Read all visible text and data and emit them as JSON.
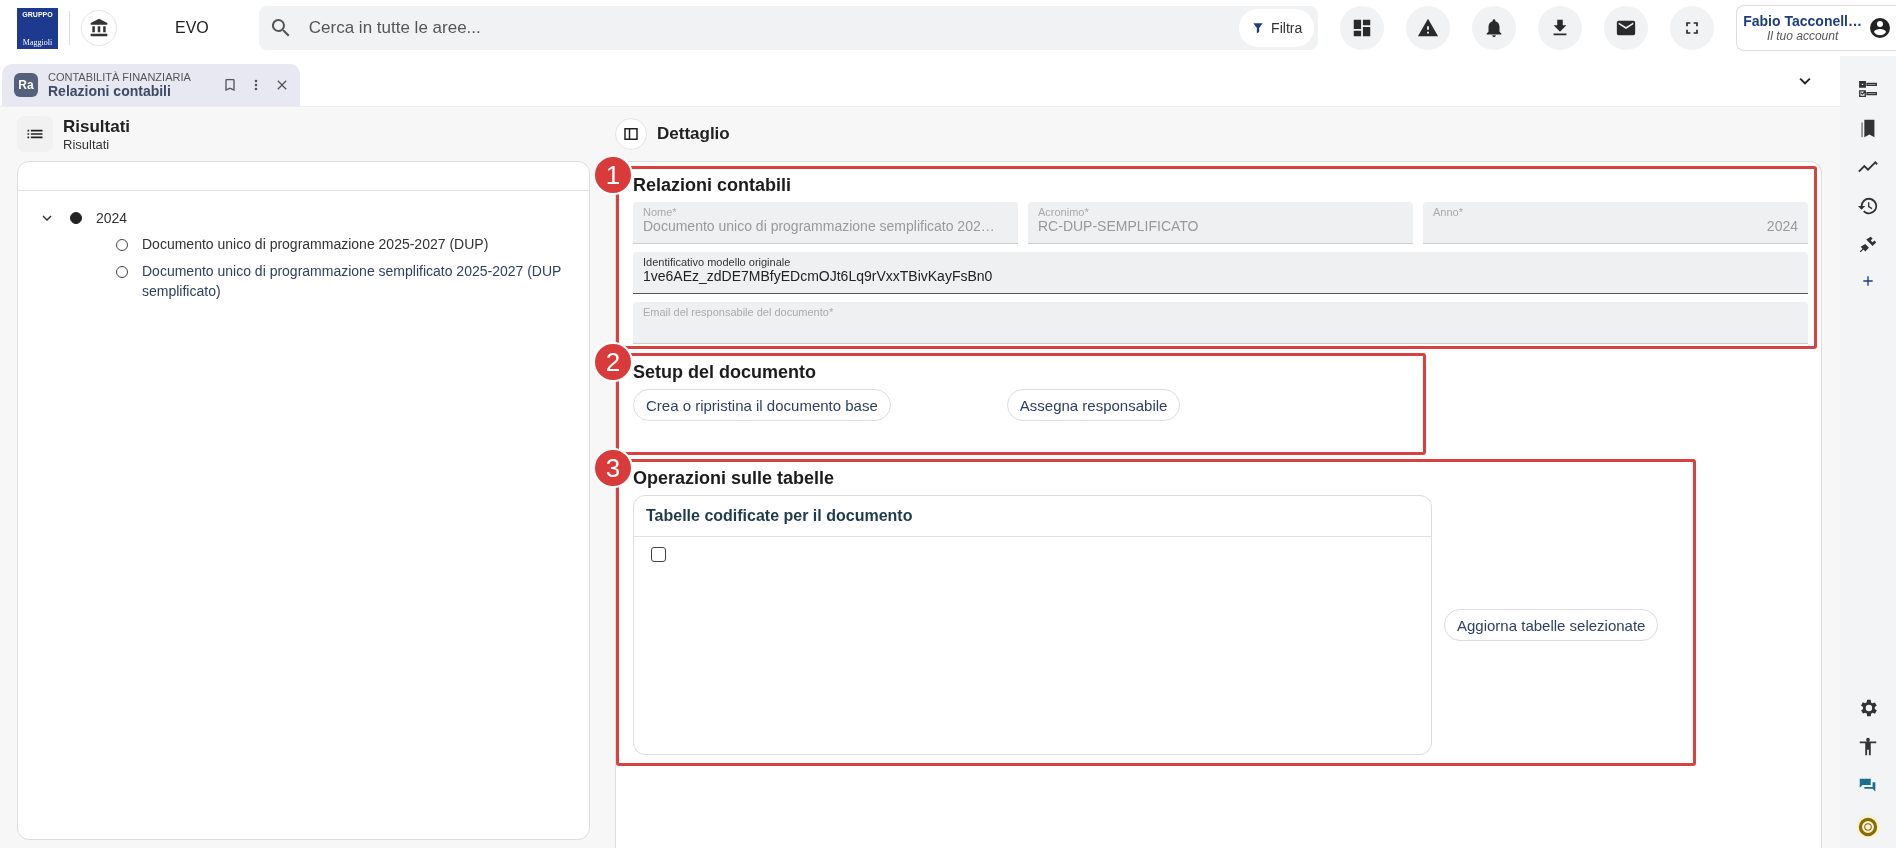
{
  "topbar": {
    "logo": {
      "top": "GRUPPO",
      "name": "Maggioli"
    },
    "app_name": "EVO",
    "search": {
      "placeholder": "Cerca in tutte le aree..."
    },
    "filter_button": "Filtra",
    "user": {
      "name": "Fabio Tacconell…",
      "subtitle": "Il tuo account"
    }
  },
  "tab": {
    "badge": "Ra",
    "category": "CONTABILITÀ FINANZIARIA",
    "title": "Relazioni contabili"
  },
  "results": {
    "title": "Risultati",
    "subtitle": "Risultati",
    "tree": [
      {
        "label": "2024",
        "expanded": true,
        "selected": true,
        "children": [
          {
            "label": "Documento unico di programmazione 2025-2027 (DUP)",
            "selected": false
          },
          {
            "label": "Documento unico di programmazione semplificato 2025-2027 (DUP semplificato)",
            "selected": false
          }
        ]
      }
    ]
  },
  "detail": {
    "title": "Dettaglio",
    "sections": [
      {
        "marker": "1",
        "title": "Relazioni contabili",
        "kind": "form",
        "field_rows": [
          {
            "fields": [
              {
                "label": "Nome",
                "required_mark": "*",
                "value": "Documento unico di programmazione semplificato 202…",
                "disabled": true,
                "kind": "text"
              },
              {
                "label": "Acronimo",
                "required_mark": "*",
                "value": "RC-DUP-SEMPLIFICATO",
                "disabled": true,
                "kind": "text"
              },
              {
                "label": "Anno",
                "required_mark": "*",
                "value": "2024",
                "disabled": true,
                "kind": "number"
              }
            ]
          },
          {
            "fields": [
              {
                "label": "Identificativo modello originale",
                "value": "1ve6AEz_zdDE7MBfyEDcmOJt6Lq9rVxxTBivKayFsBn0",
                "disabled": false,
                "kind": "text"
              }
            ]
          },
          {
            "fields": [
              {
                "label": "Email del responsabile del documento",
                "required_mark": "*",
                "disabled": true
              }
            ]
          }
        ]
      },
      {
        "marker": "2",
        "title": "Setup del documento",
        "kind": "buttons",
        "buttons": [
          "Crea o ripristina il documento base",
          "Assegna responsabile"
        ]
      },
      {
        "marker": "3",
        "title": "Operazioni sulle tabelle",
        "kind": "tables",
        "table": {
          "title": "Tabelle codificate per il documento",
          "rows": [
            {
              "checked": false
            }
          ]
        },
        "buttons": [
          "Aggiorna tabelle selezionate"
        ]
      }
    ]
  }
}
